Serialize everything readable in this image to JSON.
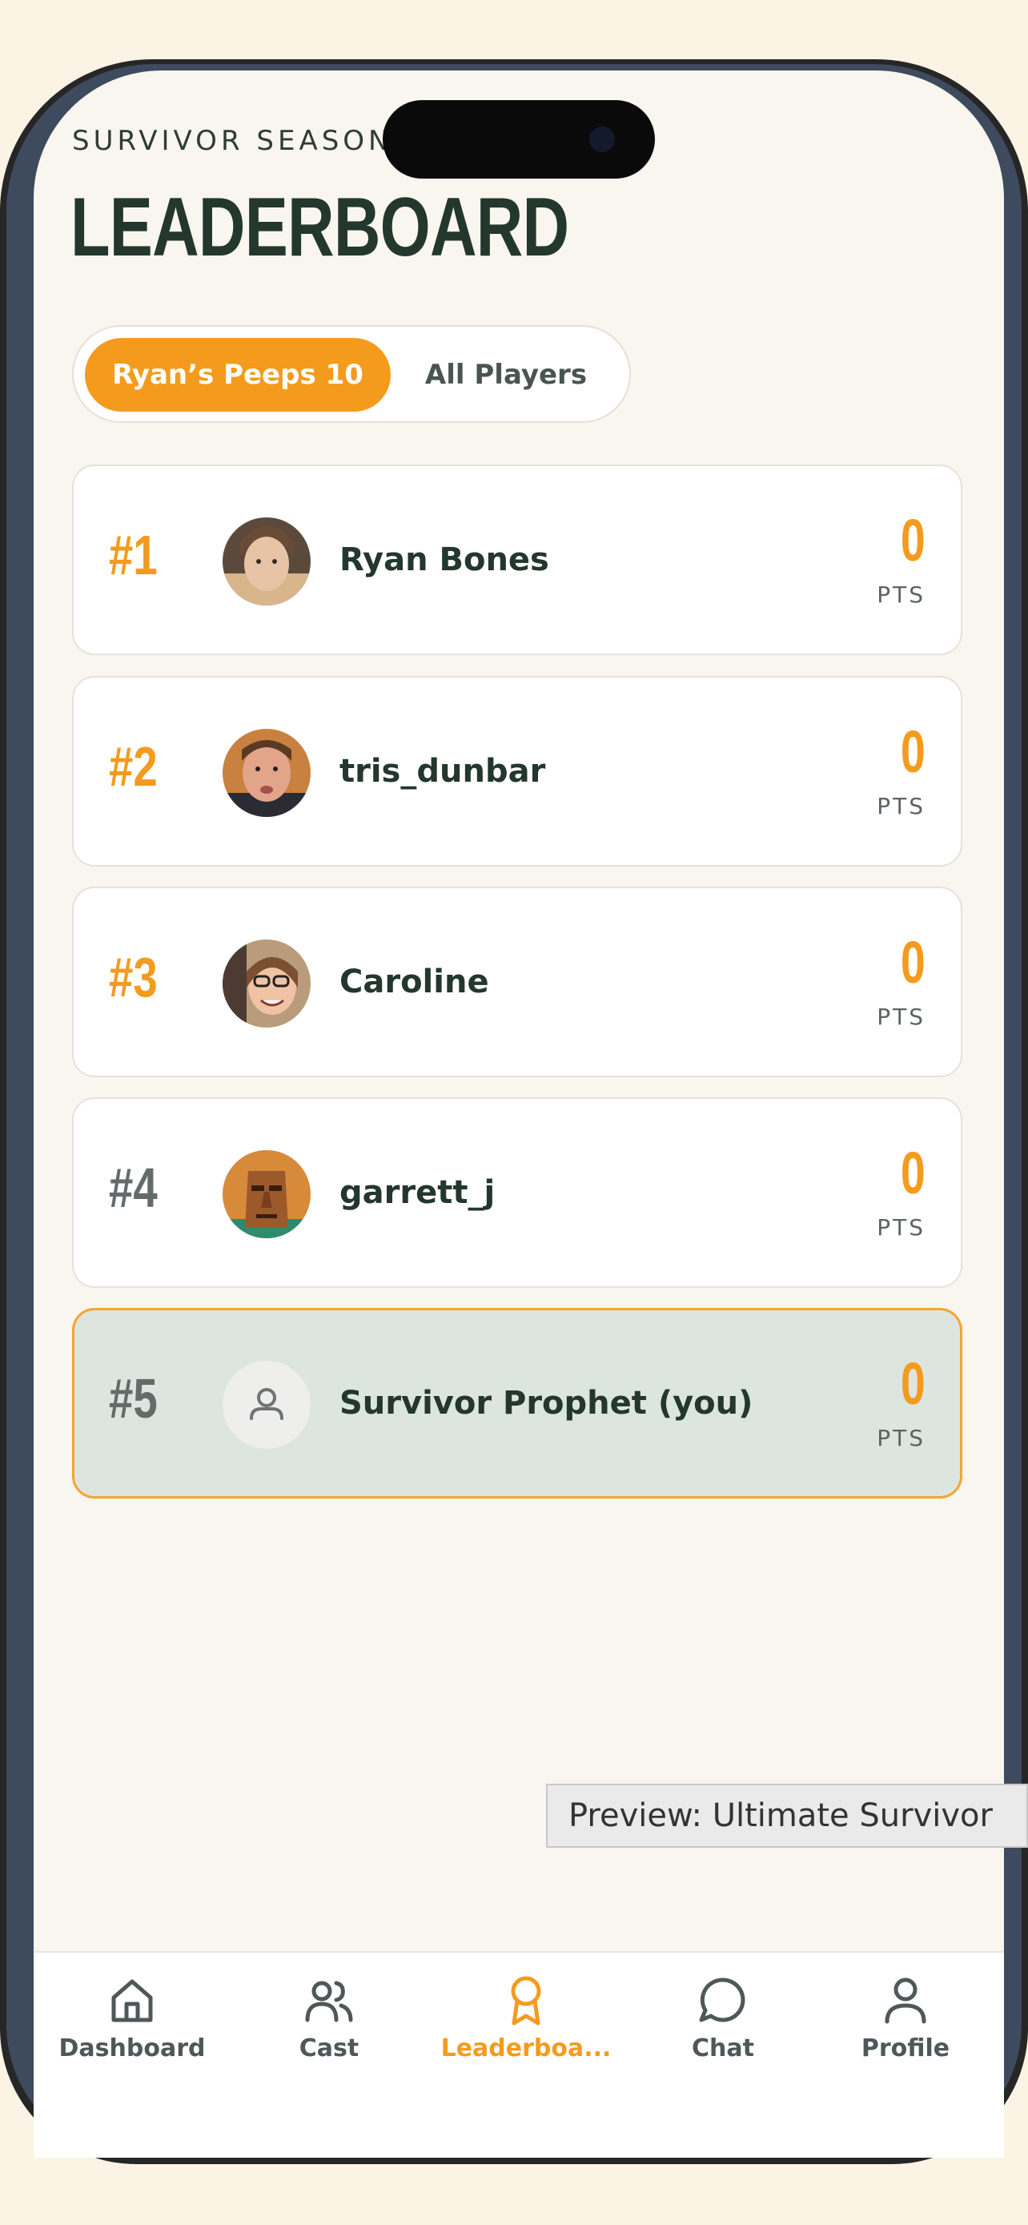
{
  "header": {
    "overline": "SURVIVOR SEASON",
    "title": "LEADERBOARD"
  },
  "toggle": {
    "active_label": "Ryan’s Peeps 10",
    "inactive_label": "All Players"
  },
  "leaderboard": [
    {
      "rank": "#1",
      "name": "Ryan Bones",
      "points": "0",
      "unit": "PTS",
      "avatar": "photo-avatar"
    },
    {
      "rank": "#2",
      "name": "tris_dunbar",
      "points": "0",
      "unit": "PTS",
      "avatar": "photo-avatar"
    },
    {
      "rank": "#3",
      "name": "Caroline",
      "points": "0",
      "unit": "PTS",
      "avatar": "photo-avatar"
    },
    {
      "rank": "#4",
      "name": "garrett_j",
      "points": "0",
      "unit": "PTS",
      "avatar": "photo-avatar"
    },
    {
      "rank": "#5",
      "name": "Survivor Prophet (you)",
      "points": "0",
      "unit": "PTS",
      "avatar": "person-icon"
    }
  ],
  "preview_tooltip": "Preview: Ultimate Survivor",
  "tabbar": [
    {
      "label": "Dashboard",
      "icon": "home-icon"
    },
    {
      "label": "Cast",
      "icon": "users-icon"
    },
    {
      "label": "Leaderboa...",
      "icon": "award-icon"
    },
    {
      "label": "Chat",
      "icon": "chat-bubble-icon"
    },
    {
      "label": "Profile",
      "icon": "user-icon"
    }
  ],
  "colors": {
    "accent": "#f49b1e",
    "title": "#23372d",
    "screen_bg": "#f9f6f0",
    "current_user_card": "#dde5df"
  }
}
